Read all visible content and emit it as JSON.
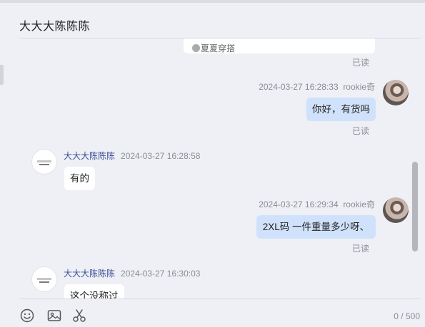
{
  "header": {
    "title": "大大大陈陈陈"
  },
  "product_card": {
    "tag": "夏夏穿搭"
  },
  "messages": [
    {
      "side": "right",
      "read": "已读"
    },
    {
      "side": "right",
      "time": "2024-03-27 16:28:33",
      "sender": "rookie奇",
      "text": "你好，有货吗",
      "read": "已读"
    },
    {
      "side": "left",
      "time": "2024-03-27 16:28:58",
      "sender": "大大大陈陈陈",
      "text": "有的"
    },
    {
      "side": "right",
      "time": "2024-03-27 16:29:34",
      "sender": "rookie奇",
      "text": "2XL码  一件重量多少呀、",
      "read": "已读"
    },
    {
      "side": "left",
      "time": "2024-03-27 16:30:03",
      "sender": "大大大陈陈陈",
      "text": "这个没称过"
    }
  ],
  "toolbar": {
    "icons": [
      "emoji-icon",
      "image-icon",
      "scissors-icon"
    ],
    "counter": "0 / 500"
  },
  "colors": {
    "background": "#eef0f5",
    "bubble_self": "#d0e2fb",
    "bubble_other": "#ffffff",
    "seller_name": "#3c4d9a"
  }
}
